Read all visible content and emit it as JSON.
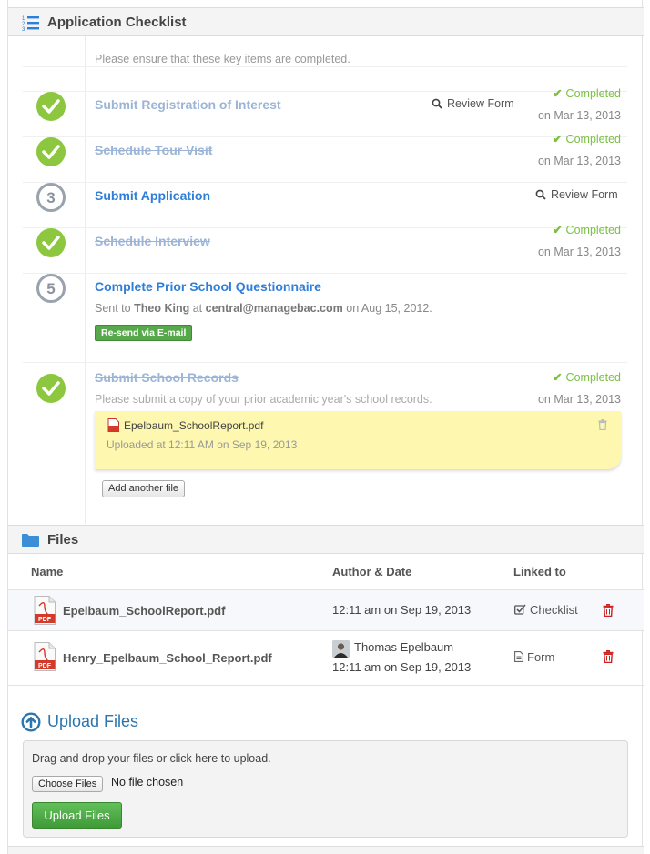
{
  "checklist": {
    "title": "Application Checklist",
    "intro": "Please ensure that these key items are completed.",
    "items": [
      {
        "step": "1",
        "title": "Submit Registration of Interest",
        "status": "Completed",
        "date": "on Mar 13, 2013",
        "review": "Review Form"
      },
      {
        "step": "2",
        "title": "Schedule Tour Visit",
        "status": "Completed",
        "date": "on Mar 13, 2013"
      },
      {
        "step": "3",
        "title": "Submit Application",
        "review": "Review Form"
      },
      {
        "step": "4",
        "title": "Schedule Interview",
        "status": "Completed",
        "date": "on Mar 13, 2013"
      },
      {
        "step": "5",
        "title": "Complete Prior School Questionnaire",
        "sent_prefix": "Sent to",
        "sent_name": "Theo King",
        "sent_at": "at",
        "sent_email": "central@managebac.com",
        "sent_date": "on Aug 15, 2012.",
        "resend": "Re-send via E-mail"
      },
      {
        "step": "6",
        "title": "Submit School Records",
        "status": "Completed",
        "date": "on Mar 13, 2013",
        "note": "Please submit a copy of your prior academic year's school records.",
        "attachment": {
          "filename": "Epelbaum_SchoolReport.pdf",
          "uploaded": "Uploaded at 12:11 AM on Sep 19, 2013"
        },
        "add_file": "Add another file"
      }
    ]
  },
  "files": {
    "title": "Files",
    "columns": {
      "name": "Name",
      "author_date": "Author & Date",
      "linked_to": "Linked to"
    },
    "rows": [
      {
        "name": "Epelbaum_SchoolReport.pdf",
        "author": "",
        "date": "12:11 am on Sep 19, 2013",
        "linked": "Checklist"
      },
      {
        "name": "Henry_Epelbaum_School_Report.pdf",
        "author": "Thomas Epelbaum",
        "date": "12:11 am on Sep 19, 2013",
        "linked": "Form"
      }
    ],
    "pdf_label": "PDF"
  },
  "upload": {
    "title": "Upload Files",
    "hint": "Drag and drop your files or click here to upload.",
    "choose": "Choose Files",
    "no_file": "No file chosen",
    "button": "Upload Files"
  },
  "colors": {
    "completed": "#7bc043",
    "link": "#2f7ed8",
    "accent": "#2d76ad",
    "delete": "#cc2222"
  }
}
